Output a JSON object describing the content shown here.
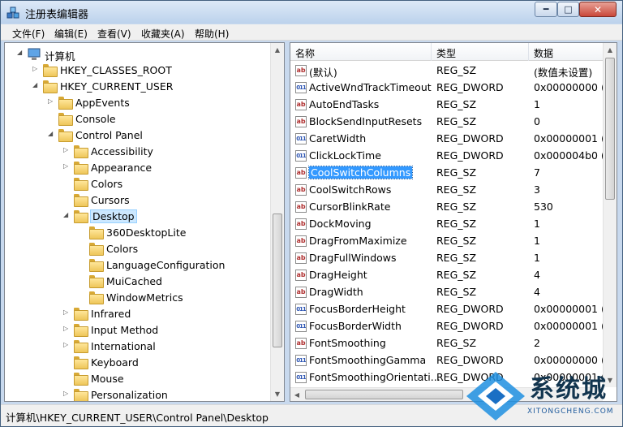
{
  "window": {
    "title": "注册表编辑器",
    "minimize": "━",
    "maximize": "□",
    "close": "✕"
  },
  "menu": [
    "文件(F)",
    "编辑(E)",
    "查看(V)",
    "收藏夹(A)",
    "帮助(H)"
  ],
  "tree": [
    {
      "label": "计算机",
      "depth": 0,
      "expander": "open",
      "icon": "computer-icon"
    },
    {
      "label": "HKEY_CLASSES_ROOT",
      "depth": 1,
      "expander": "closed"
    },
    {
      "label": "HKEY_CURRENT_USER",
      "depth": 1,
      "expander": "open"
    },
    {
      "label": "AppEvents",
      "depth": 2,
      "expander": "closed"
    },
    {
      "label": "Console",
      "depth": 2,
      "expander": "none"
    },
    {
      "label": "Control Panel",
      "depth": 2,
      "expander": "open"
    },
    {
      "label": "Accessibility",
      "depth": 3,
      "expander": "closed"
    },
    {
      "label": "Appearance",
      "depth": 3,
      "expander": "closed"
    },
    {
      "label": "Colors",
      "depth": 3,
      "expander": "none"
    },
    {
      "label": "Cursors",
      "depth": 3,
      "expander": "none"
    },
    {
      "label": "Desktop",
      "depth": 3,
      "expander": "open",
      "selected": true
    },
    {
      "label": "360DesktopLite",
      "depth": 4,
      "expander": "none"
    },
    {
      "label": "Colors",
      "depth": 4,
      "expander": "none"
    },
    {
      "label": "LanguageConfiguration",
      "depth": 4,
      "expander": "none"
    },
    {
      "label": "MuiCached",
      "depth": 4,
      "expander": "none"
    },
    {
      "label": "WindowMetrics",
      "depth": 4,
      "expander": "none"
    },
    {
      "label": "Infrared",
      "depth": 3,
      "expander": "closed"
    },
    {
      "label": "Input Method",
      "depth": 3,
      "expander": "closed"
    },
    {
      "label": "International",
      "depth": 3,
      "expander": "closed"
    },
    {
      "label": "Keyboard",
      "depth": 3,
      "expander": "none"
    },
    {
      "label": "Mouse",
      "depth": 3,
      "expander": "none"
    },
    {
      "label": "Personalization",
      "depth": 3,
      "expander": "closed"
    }
  ],
  "columns": {
    "name": "名称",
    "type": "类型",
    "data": "数据"
  },
  "values": [
    {
      "name": "(默认)",
      "type": "REG_SZ",
      "data": "(数值未设置)",
      "icon": "ab"
    },
    {
      "name": "ActiveWndTrackTimeout",
      "type": "REG_DWORD",
      "data": "0x00000000 (0",
      "icon": "bin"
    },
    {
      "name": "AutoEndTasks",
      "type": "REG_SZ",
      "data": "1",
      "icon": "ab"
    },
    {
      "name": "BlockSendInputResets",
      "type": "REG_SZ",
      "data": "0",
      "icon": "ab"
    },
    {
      "name": "CaretWidth",
      "type": "REG_DWORD",
      "data": "0x00000001 (1",
      "icon": "bin"
    },
    {
      "name": "ClickLockTime",
      "type": "REG_DWORD",
      "data": "0x000004b0 (1",
      "icon": "bin"
    },
    {
      "name": "CoolSwitchColumns",
      "type": "REG_SZ",
      "data": "7",
      "icon": "ab",
      "selected": true
    },
    {
      "name": "CoolSwitchRows",
      "type": "REG_SZ",
      "data": "3",
      "icon": "ab"
    },
    {
      "name": "CursorBlinkRate",
      "type": "REG_SZ",
      "data": "530",
      "icon": "ab"
    },
    {
      "name": "DockMoving",
      "type": "REG_SZ",
      "data": "1",
      "icon": "ab"
    },
    {
      "name": "DragFromMaximize",
      "type": "REG_SZ",
      "data": "1",
      "icon": "ab"
    },
    {
      "name": "DragFullWindows",
      "type": "REG_SZ",
      "data": "1",
      "icon": "ab"
    },
    {
      "name": "DragHeight",
      "type": "REG_SZ",
      "data": "4",
      "icon": "ab"
    },
    {
      "name": "DragWidth",
      "type": "REG_SZ",
      "data": "4",
      "icon": "ab"
    },
    {
      "name": "FocusBorderHeight",
      "type": "REG_DWORD",
      "data": "0x00000001 (1",
      "icon": "bin"
    },
    {
      "name": "FocusBorderWidth",
      "type": "REG_DWORD",
      "data": "0x00000001 (1",
      "icon": "bin"
    },
    {
      "name": "FontSmoothing",
      "type": "REG_SZ",
      "data": "2",
      "icon": "ab"
    },
    {
      "name": "FontSmoothingGamma",
      "type": "REG_DWORD",
      "data": "0x00000000 (0",
      "icon": "bin"
    },
    {
      "name": "FontSmoothingOrientati...",
      "type": "REG_DWORD",
      "data": "0x00000001 (1",
      "icon": "bin"
    }
  ],
  "icon_text": {
    "ab": "ab",
    "bin": "011"
  },
  "status": "计算机\\HKEY_CURRENT_USER\\Control Panel\\Desktop",
  "watermark": {
    "text": "系统城",
    "url": "XITONGCHENG.COM"
  }
}
